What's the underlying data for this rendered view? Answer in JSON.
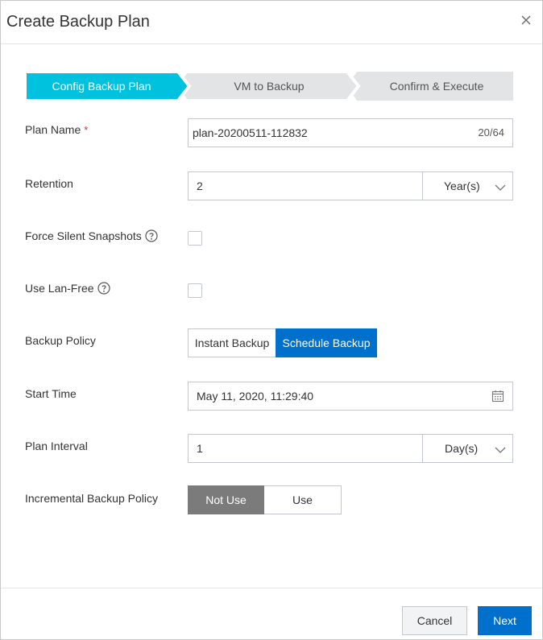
{
  "dialog": {
    "title": "Create Backup Plan"
  },
  "steps": [
    {
      "label": "Config Backup Plan",
      "active": true
    },
    {
      "label": "VM to Backup",
      "active": false
    },
    {
      "label": "Confirm & Execute",
      "active": false
    }
  ],
  "form": {
    "plan_name": {
      "label": "Plan Name",
      "required_mark": "*",
      "value": "plan-20200511-112832",
      "counter": "20/64"
    },
    "retention": {
      "label": "Retention",
      "value": "2",
      "unit": "Year(s)"
    },
    "force_silent": {
      "label": "Force Silent Snapshots",
      "checked": false
    },
    "lan_free": {
      "label": "Use Lan-Free",
      "checked": false
    },
    "backup_policy": {
      "label": "Backup Policy",
      "options": [
        "Instant Backup",
        "Schedule Backup"
      ],
      "selected": "Schedule Backup"
    },
    "start_time": {
      "label": "Start Time",
      "value": "May 11, 2020, 11:29:40"
    },
    "plan_interval": {
      "label": "Plan Interval",
      "value": "1",
      "unit": "Day(s)"
    },
    "incremental": {
      "label": "Incremental Backup Policy",
      "options": [
        "Not Use",
        "Use"
      ],
      "selected": "Not Use"
    }
  },
  "footer": {
    "cancel_label": "Cancel",
    "next_label": "Next"
  },
  "colors": {
    "step_active": "#00c1de",
    "step_inactive": "#e3e4e6",
    "primary": "#0070cc",
    "toggle_selected": "#7b7b7b"
  }
}
